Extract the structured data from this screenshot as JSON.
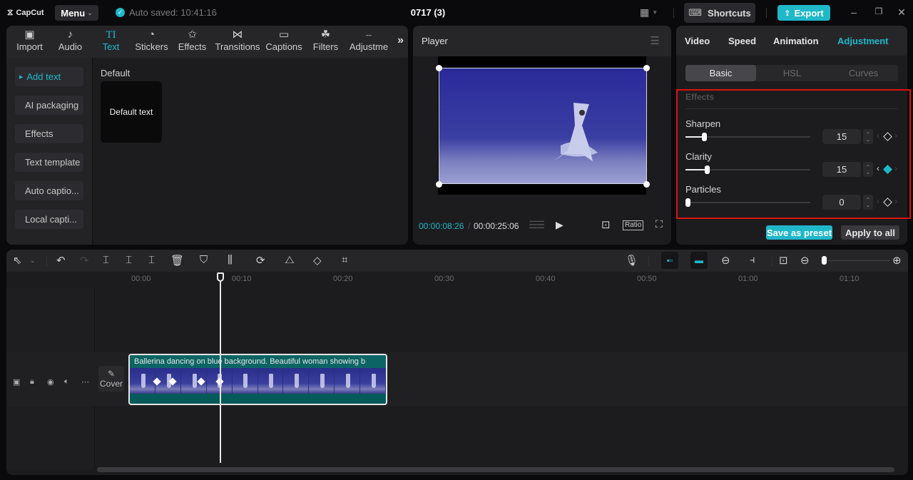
{
  "titlebar": {
    "app_name": "CapCut",
    "menu_label": "Menu",
    "autosave_text": "Auto saved: 10:41:16",
    "project_title": "0717 (3)",
    "shortcuts_label": "Shortcuts",
    "export_label": "Export"
  },
  "media_tabs": [
    {
      "label": "Import",
      "icon": "import-icon"
    },
    {
      "label": "Audio",
      "icon": "audio-icon"
    },
    {
      "label": "Text",
      "icon": "text-icon",
      "active": true
    },
    {
      "label": "Stickers",
      "icon": "stickers-icon"
    },
    {
      "label": "Effects",
      "icon": "effects-icon"
    },
    {
      "label": "Transitions",
      "icon": "transitions-icon"
    },
    {
      "label": "Captions",
      "icon": "captions-icon"
    },
    {
      "label": "Filters",
      "icon": "filters-icon"
    },
    {
      "label": "Adjustme",
      "icon": "adjustment-icon"
    }
  ],
  "text_sidebar": [
    {
      "label": "Add text",
      "active": true
    },
    {
      "label": "AI packaging"
    },
    {
      "label": "Effects"
    },
    {
      "label": "Text template"
    },
    {
      "label": "Auto captio..."
    },
    {
      "label": "Local capti..."
    }
  ],
  "text_library": {
    "section_label": "Default",
    "card_label": "Default text"
  },
  "player": {
    "title": "Player",
    "current_time": "00:00:08:26",
    "total_time": "00:00:25:06",
    "ratio_label": "Ratio"
  },
  "properties": {
    "tabs": [
      "Video",
      "Speed",
      "Animation",
      "Adjustment"
    ],
    "active_tab": "Adjustment",
    "subtabs": [
      "Basic",
      "HSL",
      "Curves"
    ],
    "active_subtab": "Basic",
    "section_label": "Effects",
    "params": [
      {
        "label": "Sharpen",
        "value": "15",
        "fraction": 0.15,
        "keyframe": false,
        "prev_active": false
      },
      {
        "label": "Clarity",
        "value": "15",
        "fraction": 0.17,
        "keyframe": true,
        "prev_active": true
      },
      {
        "label": "Particles",
        "value": "0",
        "fraction": 0.0,
        "keyframe": false,
        "prev_active": false
      }
    ],
    "save_preset_label": "Save as preset",
    "apply_all_label": "Apply to all"
  },
  "timeline": {
    "ruler_labels": [
      "00:00",
      "00:10",
      "00:20",
      "00:30",
      "00:40",
      "00:50",
      "01:00",
      "01:10"
    ],
    "cover_label": "Cover",
    "clip_title": "Ballerina dancing on blue background. Beautiful woman showing b",
    "zoom_fraction": 0.05
  },
  "colors": {
    "accent": "#1fb8c9",
    "highlight_box": "#e01010"
  }
}
